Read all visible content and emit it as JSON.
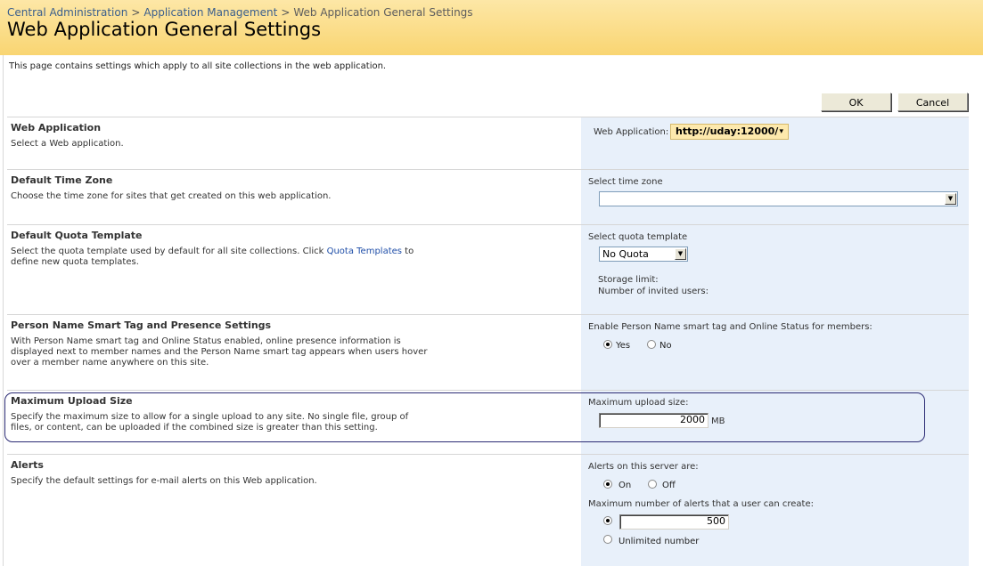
{
  "breadcrumb": {
    "items": [
      "Central Administration",
      "Application Management"
    ],
    "current": "Web Application General Settings",
    "separator": ">"
  },
  "page_title": "Web Application General Settings",
  "intro": "This page contains settings which apply to all site collections in the web application.",
  "buttons": {
    "ok": "OK",
    "cancel": "Cancel"
  },
  "sections": {
    "web_application": {
      "title": "Web Application",
      "description": "Select a Web application.",
      "control_label": "Web Application:",
      "value": "http://uday:12000/"
    },
    "time_zone": {
      "title": "Default Time Zone",
      "description": "Choose the time zone for sites that get created on this web application.",
      "control_label": "Select time zone",
      "value": ""
    },
    "quota": {
      "title": "Default Quota Template",
      "description_before_link": "Select the quota template used by default for all site collections. Click ",
      "link": "Quota Templates",
      "description_after_link": " to define new quota templates.",
      "control_label": "Select quota template",
      "value": "No Quota",
      "storage_limit": "Storage limit:",
      "invited_users": "Number of invited users:"
    },
    "person_name": {
      "title": "Person Name Smart Tag and Presence Settings",
      "description": "With Person Name smart tag and Online Status enabled, online presence information is displayed next to member names and the Person Name smart tag appears when users hover over a member name anywhere on this site.",
      "control_label": "Enable Person Name smart tag and Online Status for members:",
      "options": [
        "Yes",
        "No"
      ],
      "selected": "Yes"
    },
    "upload": {
      "title": "Maximum Upload Size",
      "description": "Specify the maximum size to allow for a single upload to any site. No single file, group of files, or content, can be uploaded if the combined size is greater than this setting.",
      "control_label": "Maximum upload size:",
      "value": "2000",
      "unit": "MB"
    },
    "alerts": {
      "title": "Alerts",
      "description": "Specify the default settings for e-mail alerts on this Web application.",
      "control_label": "Alerts on this server are:",
      "options": [
        "On",
        "Off"
      ],
      "selected": "On",
      "max_label": "Maximum number of alerts that a user can create:",
      "max_value": "500",
      "unlimited_label": "Unlimited number"
    }
  },
  "colors": {
    "header_bg": "#f9d572",
    "right_column_bg": "#e8f0fa",
    "link": "#1f4ea8",
    "highlight_border": "#2b2b74"
  },
  "icons": [
    "dropdown-arrow-icon"
  ]
}
